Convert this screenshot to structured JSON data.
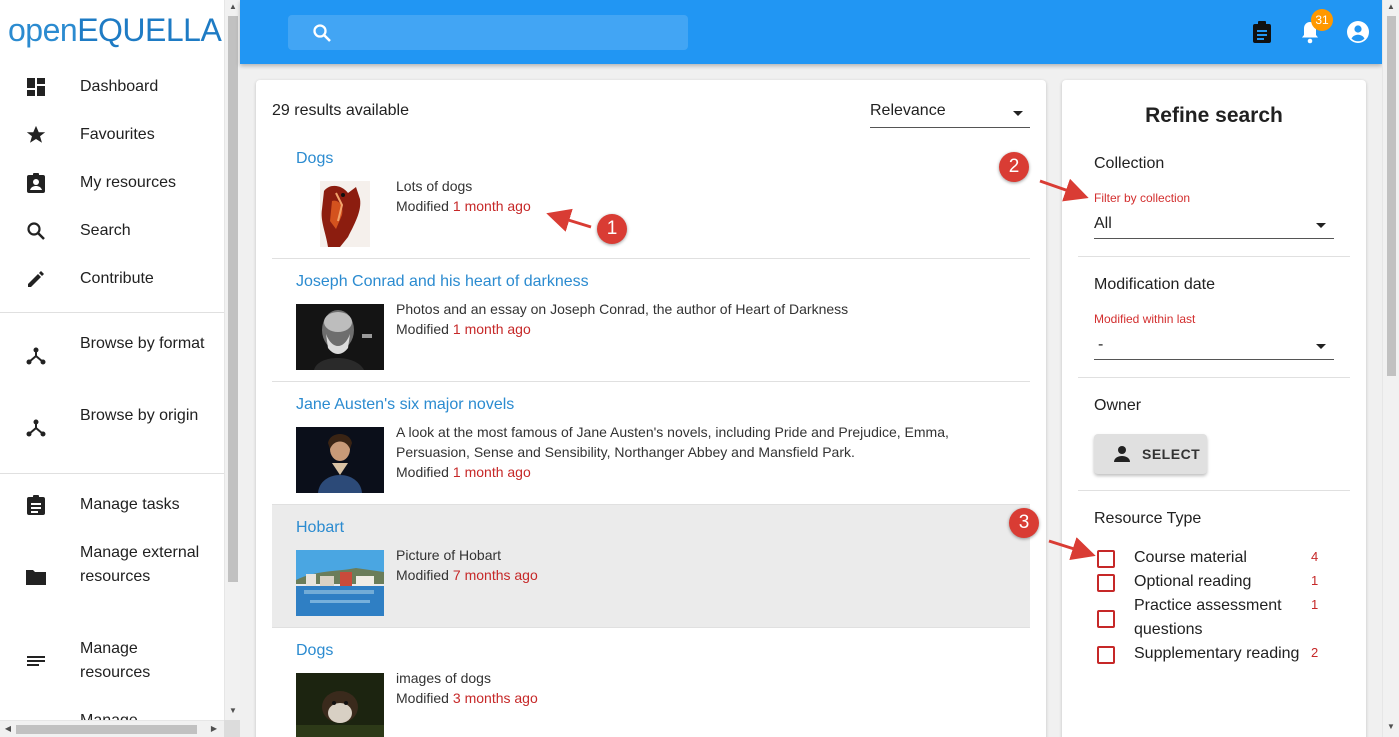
{
  "app": {
    "logo_light": "open",
    "logo_bold": "EQUELLA"
  },
  "sidebar": {
    "items": [
      {
        "label": "Dashboard",
        "icon": "dashboard-icon"
      },
      {
        "label": "Favourites",
        "icon": "star-icon"
      },
      {
        "label": "My resources",
        "icon": "assignment-ind-icon"
      },
      {
        "label": "Search",
        "icon": "search-icon"
      },
      {
        "label": "Contribute",
        "icon": "pencil-icon"
      },
      {
        "label": "Browse by format",
        "icon": "hierarchy-icon"
      },
      {
        "label": "Browse by origin",
        "icon": "hierarchy-icon"
      },
      {
        "label": "Manage tasks",
        "icon": "clipboard-icon"
      },
      {
        "label": "Manage external resources",
        "icon": "folder-icon"
      },
      {
        "label": "Manage resources",
        "icon": "list-icon"
      },
      {
        "label": "Manage",
        "icon": "list-icon"
      }
    ]
  },
  "header": {
    "search_placeholder": "",
    "notification_count": "31"
  },
  "results": {
    "count_text": "29 results available",
    "sort_value": "Relevance",
    "modified_label": "Modified",
    "items": [
      {
        "title": "Dogs",
        "description": "Lots of dogs",
        "modified": "1 month ago"
      },
      {
        "title": "Joseph Conrad and his heart of darkness",
        "description": "Photos and an essay on Joseph Conrad, the author of Heart of Darkness",
        "modified": "1 month ago"
      },
      {
        "title": "Jane Austen's six major novels",
        "description": "A look at the most famous of Jane Austen's novels, including Pride and Prejudice, Emma, Persuasion, Sense and Sensibility, Northanger Abbey and Mansfield Park.",
        "modified": "1 month ago"
      },
      {
        "title": "Hobart",
        "description": "Picture of Hobart",
        "modified": "7 months ago"
      },
      {
        "title": "Dogs",
        "description": "images of dogs",
        "modified": "3 months ago"
      }
    ]
  },
  "refine": {
    "title": "Refine search",
    "collection": {
      "title": "Collection",
      "label": "Filter by collection",
      "value": "All"
    },
    "modification": {
      "title": "Modification date",
      "label": "Modified within last",
      "value": "-"
    },
    "owner": {
      "title": "Owner",
      "button": "SELECT"
    },
    "resource_type": {
      "title": "Resource Type",
      "options": [
        {
          "label": "Course material",
          "count": "4"
        },
        {
          "label": "Optional reading",
          "count": "1"
        },
        {
          "label": "Practice assessment questions",
          "count": "1"
        },
        {
          "label": "Supplementary reading",
          "count": "2"
        }
      ]
    }
  },
  "annotations": [
    "1",
    "2",
    "3"
  ],
  "colors": {
    "appbar": "#2196f3",
    "link": "#2b8bd0",
    "accent_red": "#c62828",
    "badge": "#ff9800",
    "annotation": "#d93c34"
  }
}
